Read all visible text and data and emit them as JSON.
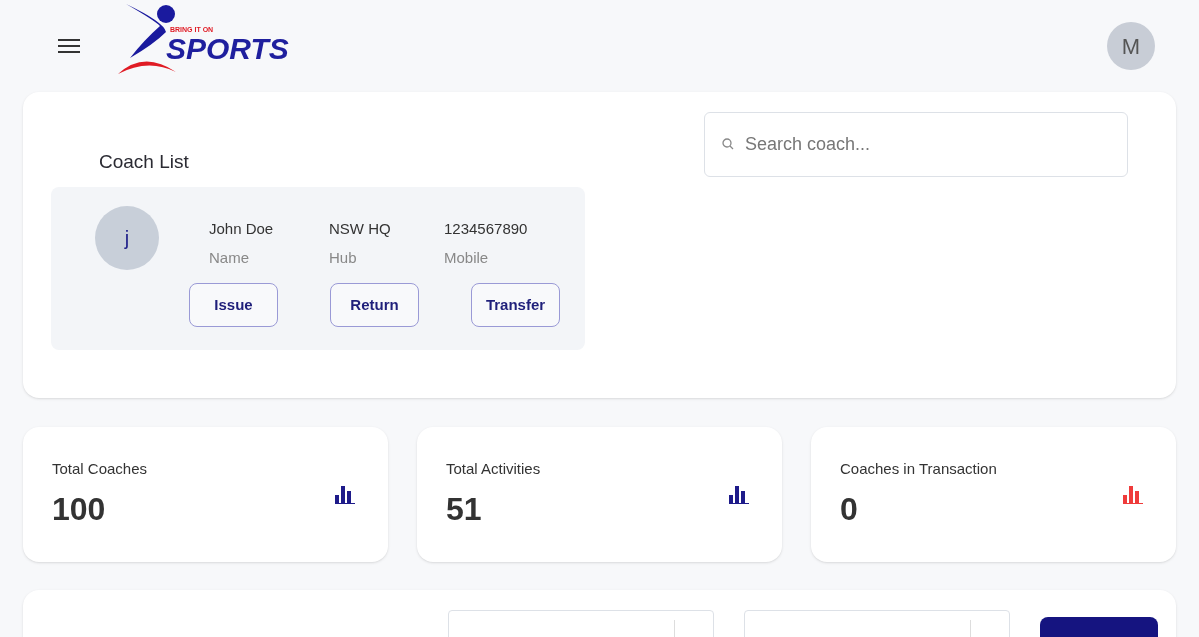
{
  "header": {
    "logo": {
      "tagline": "BRING IT ON",
      "wordmark": "SPORTS"
    },
    "user_avatar": "M"
  },
  "coach_list": {
    "title": "Coach List",
    "search": {
      "placeholder": "Search coach..."
    },
    "coaches": [
      {
        "avatar": "j",
        "fields": [
          {
            "value": "John Doe",
            "label": "Name"
          },
          {
            "value": "NSW HQ",
            "label": "Hub"
          },
          {
            "value": "1234567890",
            "label": "Mobile"
          }
        ],
        "actions": [
          "Issue",
          "Return",
          "Transfer"
        ]
      }
    ]
  },
  "stats": [
    {
      "label": "Total Coaches",
      "value": "100",
      "color": "#1e1b8a"
    },
    {
      "label": "Total Activities",
      "value": "51",
      "color": "#1e1b8a"
    },
    {
      "label": "Coaches in Transaction",
      "value": "0",
      "color": "#ef3b3b"
    }
  ],
  "filters": [
    {
      "kind": "dropdown"
    },
    {
      "kind": "dropdown"
    }
  ]
}
